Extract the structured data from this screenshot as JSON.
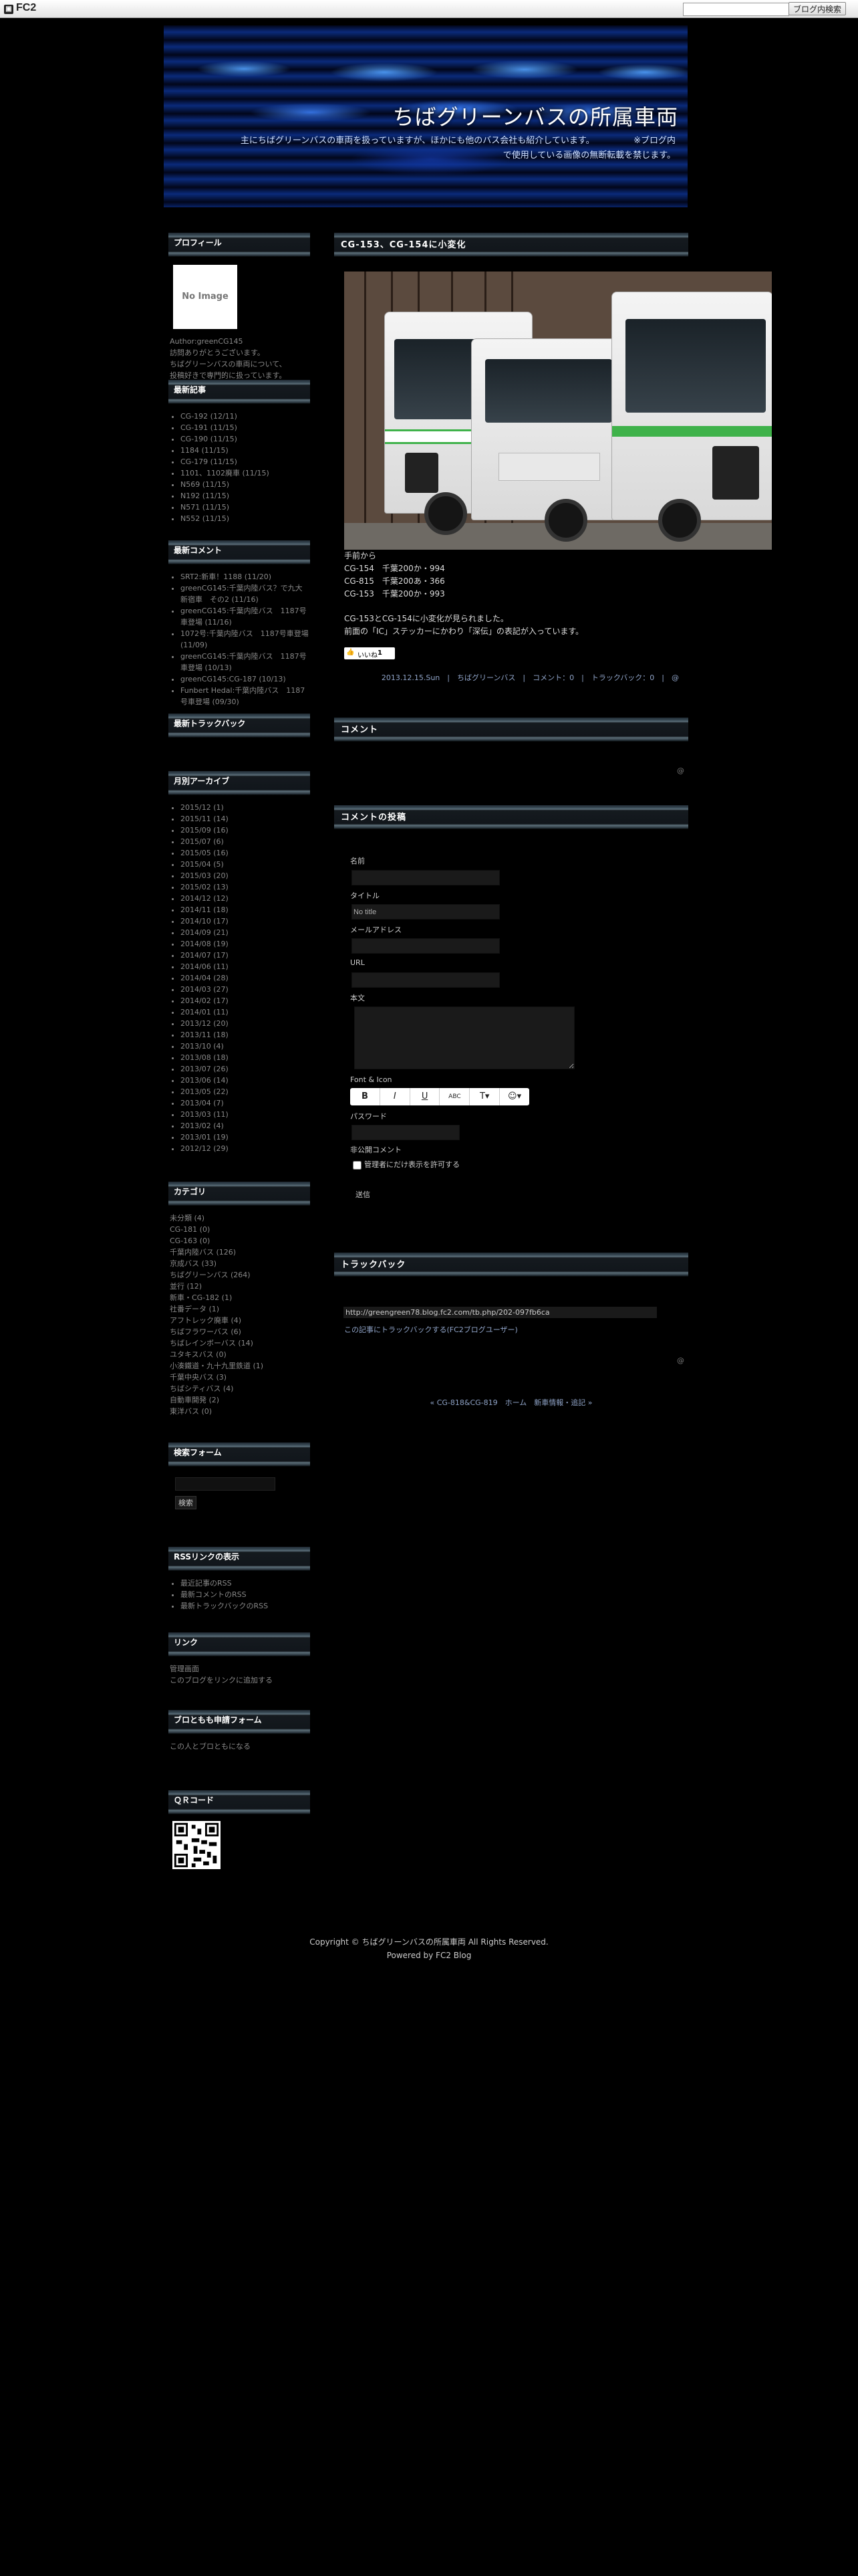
{
  "fc2": {
    "logo": "FC2",
    "search_button": "ブログ内検索",
    "search_value": ""
  },
  "header": {
    "title": "ちばグリーンバスの所属車両",
    "desc_line1": "主にちばグリーンバスの車両を扱っていますが、ほかにも他のバス会社も紹介しています。　　　　　※ブログ内",
    "desc_line2": "で使用している画像の無断転載を禁じます。"
  },
  "sidebar": {
    "profile": {
      "title": "プロフィール",
      "noimage": "No Image",
      "author": "Author:greenCG145",
      "text1": "訪問ありがとうございます。",
      "text2": "ちばグリーンバスの車両について、",
      "text3": "投稿好きで専門的に扱っています。"
    },
    "recent_entries": {
      "title": "最新記事",
      "items": [
        "CG-192 (12/11)",
        "CG-191 (11/15)",
        "CG-190 (11/15)",
        "1184 (11/15)",
        "CG-179 (11/15)",
        "1101、1102廃車 (11/15)",
        "N569 (11/15)",
        "N192 (11/15)",
        "N571 (11/15)",
        "N552 (11/15)"
      ]
    },
    "recent_comments": {
      "title": "最新コメント",
      "items": [
        "SRT2:新車！1188 (11/20)",
        "greenCG145:千葉内陸バス？で九大新宿車　その2 (11/16)",
        "greenCG145:千葉内陸バス　1187号車登場 (11/16)",
        "1072号:千葉内陸バス　1187号車登場 (11/09)",
        "greenCG145:千葉内陸バス　1187号車登場 (10/13)",
        "greenCG145:CG-187 (10/13)",
        "Funbert Hedal:千葉内陸バス　1187号車登場 (09/30)"
      ]
    },
    "trackback": {
      "title": "最新トラックバック"
    },
    "archives": {
      "title": "月別アーカイブ",
      "items": [
        "2015/12 (1)",
        "2015/11 (14)",
        "2015/09 (16)",
        "2015/07 (6)",
        "2015/05 (16)",
        "2015/04 (5)",
        "2015/03 (20)",
        "2015/02 (13)",
        "2014/12 (12)",
        "2014/11 (18)",
        "2014/10 (17)",
        "2014/09 (21)",
        "2014/08 (19)",
        "2014/07 (17)",
        "2014/06 (11)",
        "2014/04 (28)",
        "2014/03 (27)",
        "2014/02 (17)",
        "2014/01 (11)",
        "2013/12 (20)",
        "2013/11 (18)",
        "2013/10 (4)",
        "2013/08 (18)",
        "2013/07 (26)",
        "2013/06 (14)",
        "2013/05 (22)",
        "2013/04 (7)",
        "2013/03 (11)",
        "2013/02 (4)",
        "2013/01 (19)",
        "2012/12 (29)"
      ]
    },
    "categories": {
      "title": "カテゴリ",
      "items": [
        "未分類 (4)",
        "CG-181 (0)",
        "CG-163 (0)",
        "千葉内陸バス (126)",
        "京成バス (33)",
        "ちばグリーンバス (264)",
        "並行 (12)",
        "新車・CG-182 (1)",
        "社番データ (1)",
        "アフトレック廃車 (4)",
        "ちばフラワーバス (6)",
        "ちばレインボーバス (14)",
        "ユタキスバス (0)",
        "小湊鐵道・九十九里鉄道 (1)",
        "千葉中央バス (3)",
        "ちばシティバス (4)",
        "自動車開発 (2)",
        "東洋バス (0)"
      ]
    },
    "search": {
      "title": "検索フォーム",
      "button": "検索",
      "value": ""
    },
    "rss": {
      "title": "RSSリンクの表示",
      "items": [
        "最近記事のRSS",
        "最新コメントのRSS",
        "最新トラックバックのRSS"
      ]
    },
    "links": {
      "title": "リンク",
      "items": [
        "管理画面",
        "このブログをリンクに追加する"
      ]
    },
    "friend": {
      "title": "ブロともも申請フォーム",
      "text": "この人とブロともになる"
    },
    "qr": {
      "title": "ＱＲコード"
    }
  },
  "post": {
    "title": "CG-153、CG-154に小変化",
    "lines": [
      "手前から",
      "CG-154　千葉200か・994",
      "CG-815　千葉200あ・366",
      "CG-153　千葉200か・993"
    ],
    "body1": "CG-153とCG-154に小変化が見られました。",
    "body2": "前面の「IC」ステッカーにかわり「深伝」の表記が入っています。",
    "like_label": "いいね",
    "like_count": "1",
    "meta": "2013.12.15.Sun　|　ちばグリーンバス　|　コメント：0　|　トラックバック：0　|　@"
  },
  "comments": {
    "title": "コメント",
    "top_label": "@"
  },
  "form": {
    "title": "コメントの投稿",
    "name_label": "名前",
    "title_label": "タイトル",
    "title_value": "No title",
    "mail_label": "メールアドレス",
    "url_label": "URL",
    "body_label": "本文",
    "font_label": "Font & Icon",
    "toolbar": [
      "B",
      "I",
      "U",
      "ABC",
      "T▾",
      "☺▾"
    ],
    "password_label": "パスワード",
    "secret_label": "非公開コメント",
    "checkbox_label": "管理者にだけ表示を許可する",
    "submit": "送信"
  },
  "trackback": {
    "title": "トラックバック",
    "url": "http://greengreen78.blog.fc2.com/tb.php/202-097fb6ca",
    "link": "この記事にトラックバックする(FC2ブログユーザー)",
    "top_label": "@"
  },
  "pager": "« CG-818&CG-819　ホーム　新車情報・追記 »",
  "footer": {
    "copyright": "Copyright © ちばグリーンバスの所属車両 All Rights Reserved.",
    "powered": "Powered by FC2 Blog"
  }
}
